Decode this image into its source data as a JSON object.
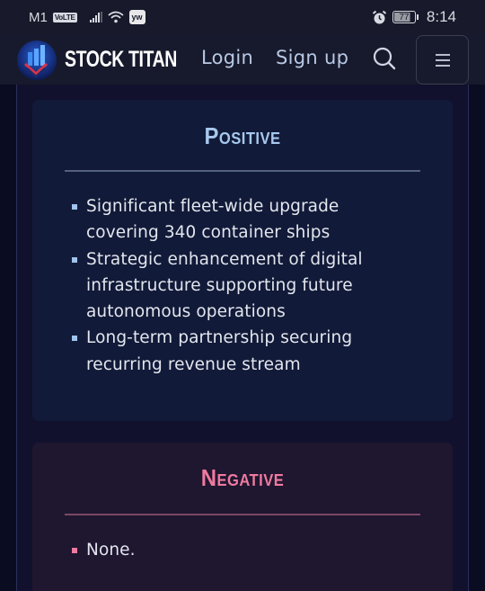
{
  "status_bar": {
    "carrier": "M1",
    "volte": "VoLTE",
    "app_badge": "yw",
    "battery": "77",
    "time": "8:14"
  },
  "nav": {
    "brand": "STOCK TITAN",
    "login": "Login",
    "signup": "Sign up",
    "icons": {
      "logo": "stock-titan-logo",
      "search": "search-icon",
      "menu": "hamburger-menu-icon"
    }
  },
  "positive": {
    "title": "Positive",
    "items": [
      "Significant fleet-wide upgrade covering 340 container ships",
      "Strategic enhancement of digital infrastructure supporting future autonomous operations",
      "Long-term partnership securing recurring revenue stream"
    ],
    "accent": "#a7c8ee"
  },
  "negative": {
    "title": "Negative",
    "items": [
      "None."
    ],
    "accent": "#ef7a9f"
  }
}
